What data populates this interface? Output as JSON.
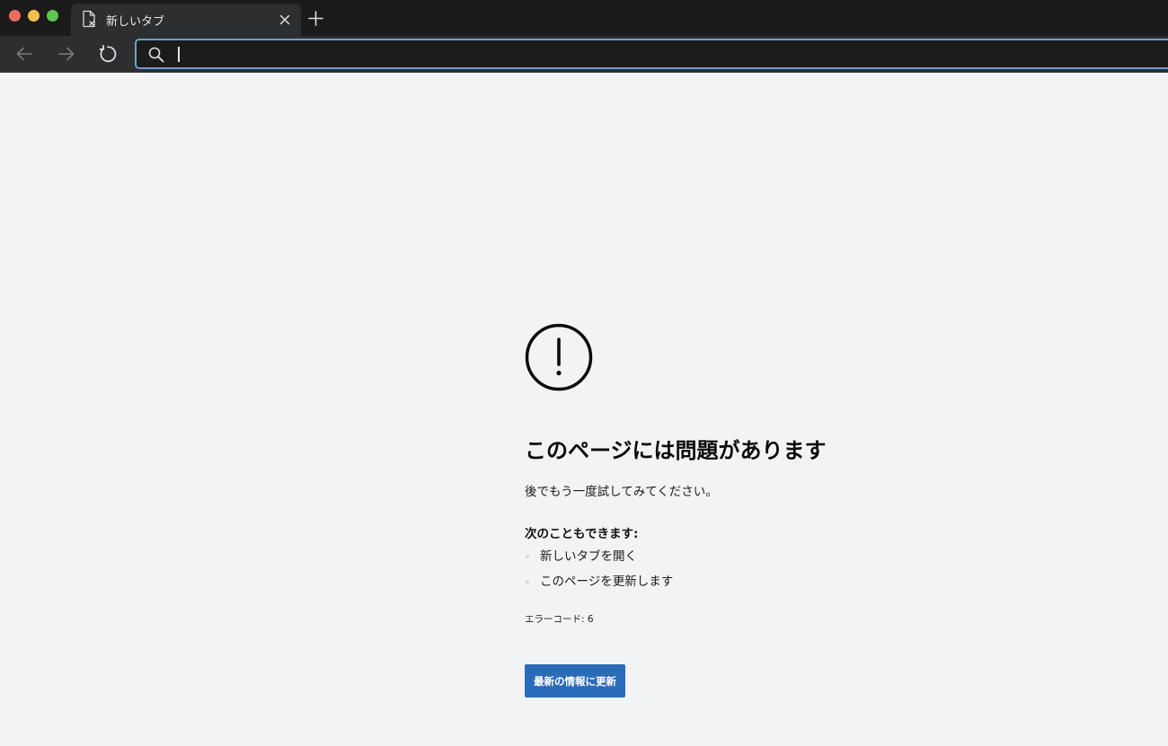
{
  "browser": {
    "tab": {
      "title": "新しいタブ"
    },
    "address_bar": {
      "value": ""
    },
    "icons": {
      "tab": "document-error-icon",
      "close": "close-icon",
      "new_tab": "plus-icon",
      "back": "back-arrow-icon",
      "forward": "forward-arrow-icon",
      "reload": "reload-icon",
      "search": "search-icon"
    },
    "colors": {
      "traffic_red": "#ed6a5e",
      "traffic_yellow": "#f5bf4f",
      "traffic_green": "#61c554",
      "address_focus": "#6ba0d6"
    }
  },
  "error_page": {
    "icon": "exclamation-circle-icon",
    "title": "このページには問題があります",
    "message": "後でもう一度試してみてください。",
    "options_heading": "次のこともできます:",
    "options": [
      {
        "label": "新しいタブを開く"
      },
      {
        "label": "このページを更新します"
      }
    ],
    "error_code": "エラーコード: 6",
    "button_label": "最新の情報に更新",
    "colors": {
      "background": "#f2f3f5",
      "button": "#2b6cb9"
    }
  }
}
